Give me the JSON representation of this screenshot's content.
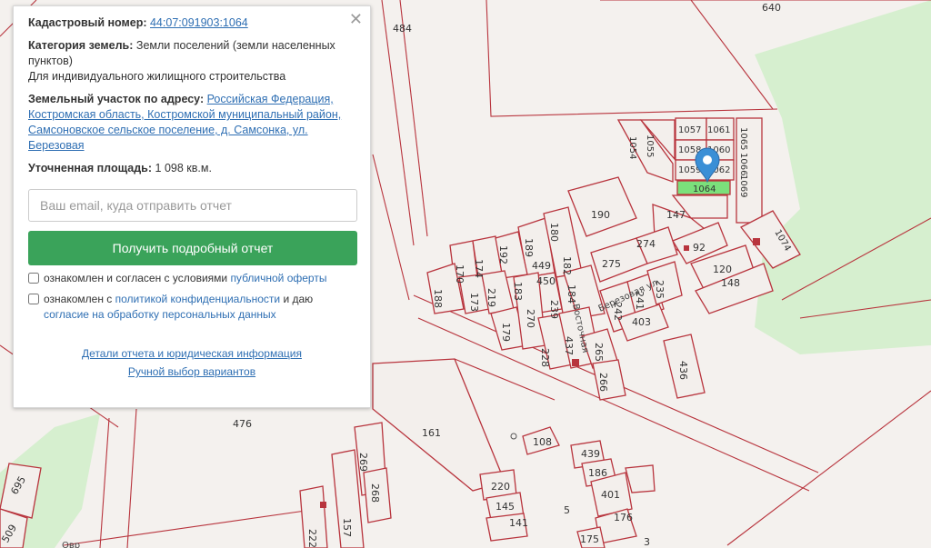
{
  "panel": {
    "cadastral_label": "Кадастровый номер:",
    "cadastral_value": "44:07:091903:1064",
    "category_label": "Категория земель:",
    "category_value": "Земли поселений (земли населенных пунктов)",
    "category_use": "Для индивидуального жилищного строительства",
    "address_label": "Земельный участок по адресу:",
    "address_value": "Российская Федерация, Костромская область, Костромской муниципальный район, Самсоновское сельское поселение, д. Самсонка, ул. Березовая",
    "area_label": "Уточненная площадь:",
    "area_value": "1 098 кв.м.",
    "email_placeholder": "Ваш email, куда отправить отчет",
    "submit_label": "Получить подробный отчет",
    "consent1_text": "ознакомлен и согласен с условиями ",
    "consent1_link": "публичной оферты",
    "consent2_text": "ознакомлен с ",
    "consent2_link": "политикой конфиденциальности",
    "consent2_mid": " и даю",
    "consent2_link2": "согласие на обработку персональных данных",
    "details_link": "Детали отчета и юридическая информация",
    "manual_link": "Ручной выбор вариантов"
  },
  "map": {
    "highlight_color": "#7be07b",
    "marker_color": "#3a8fd6",
    "plot_border_color": "#b8343d",
    "selected_plot": "1064",
    "streets": [
      "Березовая ул.",
      "Восточная",
      "Овр"
    ],
    "plot_labels": [
      "640",
      "484",
      "1057",
      "1061",
      "1058",
      "1060",
      "1059",
      "1062",
      "1064",
      "1054",
      "1055",
      "1065",
      "1066",
      "1069",
      "190",
      "147",
      "275",
      "274",
      "92",
      "1074",
      "120",
      "148",
      "189",
      "180",
      "182",
      "449",
      "450",
      "184",
      "170",
      "174",
      "192",
      "219",
      "183",
      "173",
      "179",
      "270",
      "239",
      "437",
      "228",
      "265",
      "266",
      "242",
      "241",
      "235",
      "403",
      "436",
      "188",
      "161",
      "476",
      "108",
      "439",
      "186",
      "401",
      "220",
      "145",
      "141",
      "175",
      "176",
      "269",
      "268",
      "157",
      "222",
      "695",
      "509",
      "3",
      "5"
    ]
  }
}
